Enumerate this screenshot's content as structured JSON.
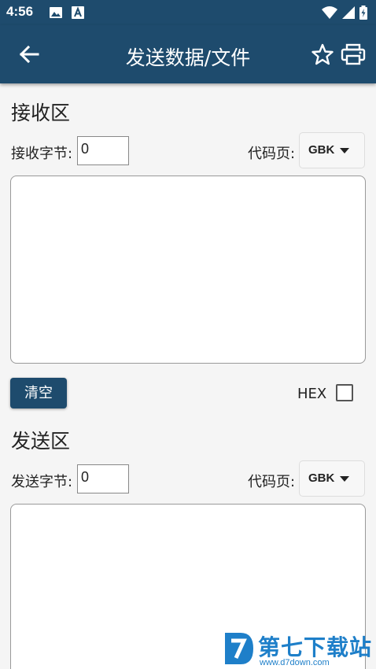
{
  "status_bar": {
    "time": "4:56",
    "left_icons": [
      "image-icon",
      "a-letter-icon"
    ],
    "right_icons": [
      "wifi-icon",
      "signal-icon",
      "battery-icon"
    ]
  },
  "app_bar": {
    "title": "发送数据/文件",
    "background": "#1e4b6d",
    "icons": [
      "back-arrow-icon",
      "star-icon",
      "printer-icon"
    ]
  },
  "receive": {
    "section_title": "接收区",
    "bytes_label": "接收字节:",
    "bytes_value": "0",
    "codepage_label": "代码页:",
    "codepage_value": "GBK",
    "clear_button": "清空",
    "hex_label": "HEX",
    "hex_checked": false
  },
  "send": {
    "section_title": "发送区",
    "bytes_label": "发送字节:",
    "bytes_value": "0",
    "codepage_label": "代码页:",
    "codepage_value": "GBK"
  },
  "watermark": {
    "name": "第七下载站",
    "url": "www.d7down.com"
  }
}
